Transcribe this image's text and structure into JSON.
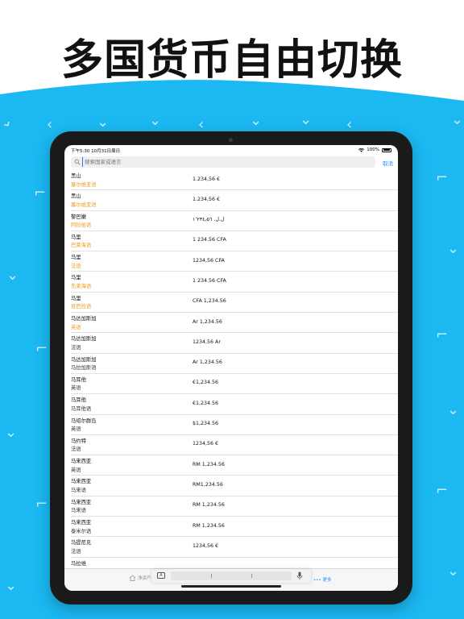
{
  "headline": "多国货币自由切换",
  "status": {
    "time": "下午5:30",
    "date": "10月31日周日",
    "battery": "100%"
  },
  "search": {
    "placeholder": "搜索国家或语言",
    "cancel_label": "取消"
  },
  "rows": [
    {
      "name": "黑山",
      "lang": "塞尔维亚语",
      "amount": "1.234,56 €",
      "lang_color": "#f29b1c"
    },
    {
      "name": "黑山",
      "lang": "塞尔维亚语",
      "amount": "1.234,56 €",
      "lang_color": "#f29b1c"
    },
    {
      "name": "黎巴嫩",
      "lang": "阿拉伯语",
      "amount": "ل.ل.‏ ١٬٢٣٤٫٥٦",
      "lang_color": "#f29b1c"
    },
    {
      "name": "马里",
      "lang": "巴莱海语",
      "amount": "1 234.56 CFA",
      "lang_color": "#f29b1c"
    },
    {
      "name": "马里",
      "lang": "法语",
      "amount": "1234,56 CFA",
      "lang_color": "#f29b1c"
    },
    {
      "name": "马里",
      "lang": "东莱海语",
      "amount": "1 234.56 CFA",
      "lang_color": "#f29b1c"
    },
    {
      "name": "马里",
      "lang": "班巴拉语",
      "amount": "CFA 1,234.56",
      "lang_color": "#f29b1c"
    },
    {
      "name": "马达加斯加",
      "lang": "英语",
      "amount": "Ar 1,234.56",
      "lang_color": "#f29b1c"
    },
    {
      "name": "马达加斯加",
      "lang": "法语",
      "amount": "1234,56 Ar",
      "lang_color": "#333333"
    },
    {
      "name": "马达加斯加",
      "lang": "马拉加斯语",
      "amount": "Ar 1,234.56",
      "lang_color": "#333333"
    },
    {
      "name": "马耳他",
      "lang": "英语",
      "amount": "€1,234.56",
      "lang_color": "#333333"
    },
    {
      "name": "马耳他",
      "lang": "马耳他语",
      "amount": "€1,234.56",
      "lang_color": "#333333"
    },
    {
      "name": "马绍尔群岛",
      "lang": "英语",
      "amount": "$1,234.56",
      "lang_color": "#333333"
    },
    {
      "name": "马约特",
      "lang": "法语",
      "amount": "1234,56 €",
      "lang_color": "#333333"
    },
    {
      "name": "马来西亚",
      "lang": "英语",
      "amount": "RM 1,234.56",
      "lang_color": "#333333"
    },
    {
      "name": "马来西亚",
      "lang": "马来语",
      "amount": "RM1,234.56",
      "lang_color": "#333333"
    },
    {
      "name": "马来西亚",
      "lang": "马来语",
      "amount": "RM 1,234.56",
      "lang_color": "#333333"
    },
    {
      "name": "马来西亚",
      "lang": "泰米尔语",
      "amount": "RM 1,234.56",
      "lang_color": "#333333"
    },
    {
      "name": "马提尼克",
      "lang": "法语",
      "amount": "1234,56 €",
      "lang_color": "#333333"
    },
    {
      "name": "马拉维",
      "lang": "",
      "amount": "",
      "lang_color": "#333333"
    }
  ],
  "tabbar": {
    "home_label": "净资产",
    "more_label": "••• 更多"
  },
  "colors": {
    "brand_blue": "#1bb8f2",
    "accent": "#1e90ff",
    "orange": "#f29b1c"
  },
  "icons": {
    "search": "search-icon",
    "home": "home-icon",
    "keyboard": "keyboard-icon",
    "mic": "microphone-icon"
  }
}
